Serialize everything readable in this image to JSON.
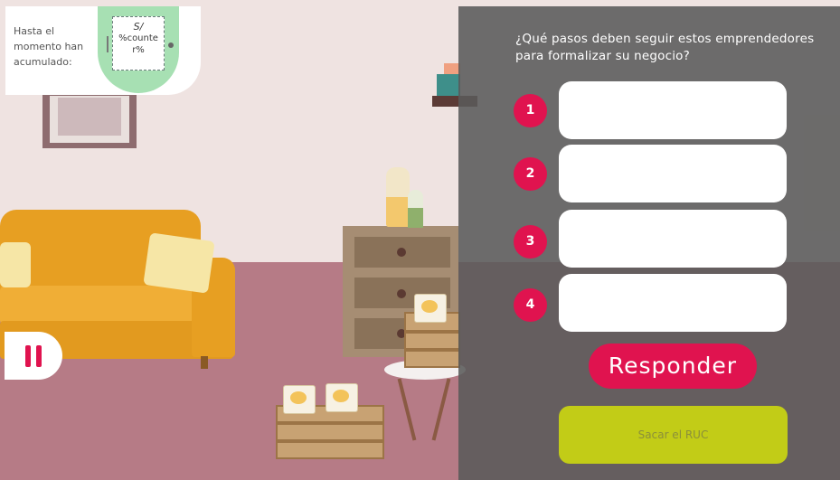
{
  "hud": {
    "accumulated_label": "Hasta el momento han acumulado:",
    "currency": "S/",
    "counter_value": "%counter%"
  },
  "controls": {
    "pause_icon": "pause-icon"
  },
  "quiz": {
    "question": "¿Qué pasos deben seguir estos emprendedores para formalizar su negocio?",
    "steps": [
      {
        "number": "1",
        "value": "",
        "placeholder": ""
      },
      {
        "number": "2",
        "value": "",
        "placeholder": ""
      },
      {
        "number": "3",
        "value": "",
        "placeholder": ""
      },
      {
        "number": "4",
        "value": "",
        "placeholder": ""
      }
    ],
    "submit_label": "Responder",
    "option_label": "Sacar el RUC"
  },
  "colors": {
    "accent": "#e0134f",
    "option": "#c2cc17",
    "overlay": "#5a5a5a"
  }
}
